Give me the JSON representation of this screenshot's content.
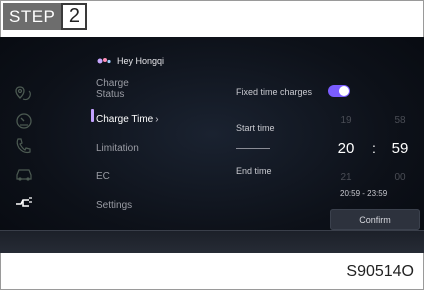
{
  "header": {
    "step_label": "STEP",
    "step_number": "2"
  },
  "screen": {
    "user_name": "Hey Hongqi",
    "side_icons": [
      "route-pin-icon",
      "gauge-icon",
      "phone-icon",
      "car-icon",
      "charging-plug-icon"
    ],
    "menu": [
      {
        "line1": "Charge",
        "line2": "Status"
      },
      {
        "line1": "Charge Time",
        "chevron": "›"
      },
      {
        "line1": "Limitation"
      },
      {
        "line1": "EC"
      },
      {
        "line1": "Settings"
      }
    ],
    "fixed_time_label": "Fixed time charges",
    "fixed_time_enabled": true,
    "start_time_label": "Start time",
    "end_time_label": "End time",
    "picker": {
      "hour_prev": "19",
      "minute_prev": "58",
      "hour_sel": "20",
      "separator": ":",
      "minute_sel": "59",
      "hour_next": "21",
      "minute_next": "00"
    },
    "time_range": "20:59 - 23:59",
    "confirm_label": "Confirm",
    "accent": "#7a5cff"
  },
  "figure_code": "S90514O"
}
